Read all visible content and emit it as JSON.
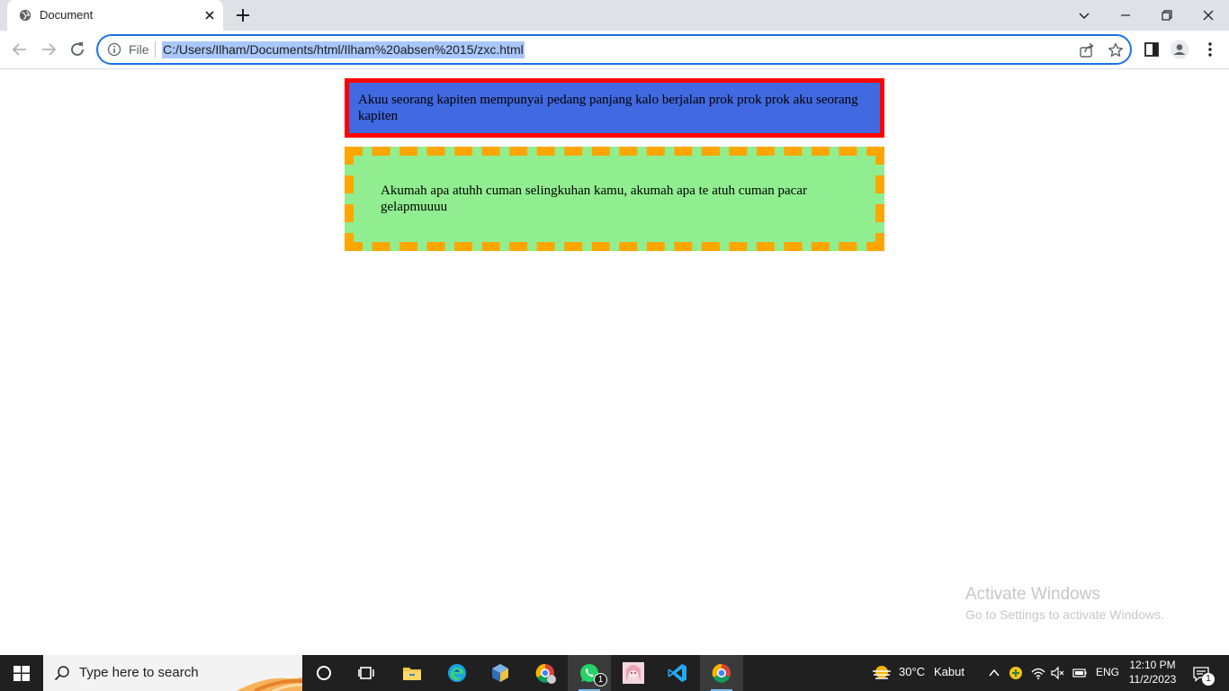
{
  "browser": {
    "tab_title": "Document",
    "omnibox": {
      "scheme_label": "File",
      "url": "C:/Users/Ilham/Documents/html/Ilham%20absen%2015/zxc.html"
    }
  },
  "page": {
    "box_blue_text": "Akuu seorang kapiten mempunyai pedang panjang kalo berjalan prok prok prok aku seorang kapiten",
    "box_green_text": "Akumah apa atuhh cuman selingkuhan kamu, akumah apa te atuh cuman pacar gelapmuuuu",
    "box_blue_bg": "#4169e1",
    "box_blue_border": "#ff0000",
    "box_green_bg": "#90ee90",
    "box_green_border": "#ffa500"
  },
  "watermark": {
    "title": "Activate Windows",
    "subtitle": "Go to Settings to activate Windows."
  },
  "taskbar": {
    "search_placeholder": "Type here to search",
    "weather_temp": "30°C",
    "weather_desc": "Kabut",
    "language": "ENG",
    "time": "12:10 PM",
    "date": "11/2/2023",
    "whatsapp_badge": "1",
    "notification_badge": "1",
    "apps": [
      "task-view",
      "widgets",
      "file-explorer",
      "edge",
      "virtualbox",
      "chrome-profile",
      "whatsapp",
      "anime-app",
      "vscode",
      "chrome"
    ]
  },
  "colors": {
    "accent": "#1a73e8",
    "taskbar": "#202020",
    "tabstrip": "#dee1e6"
  }
}
